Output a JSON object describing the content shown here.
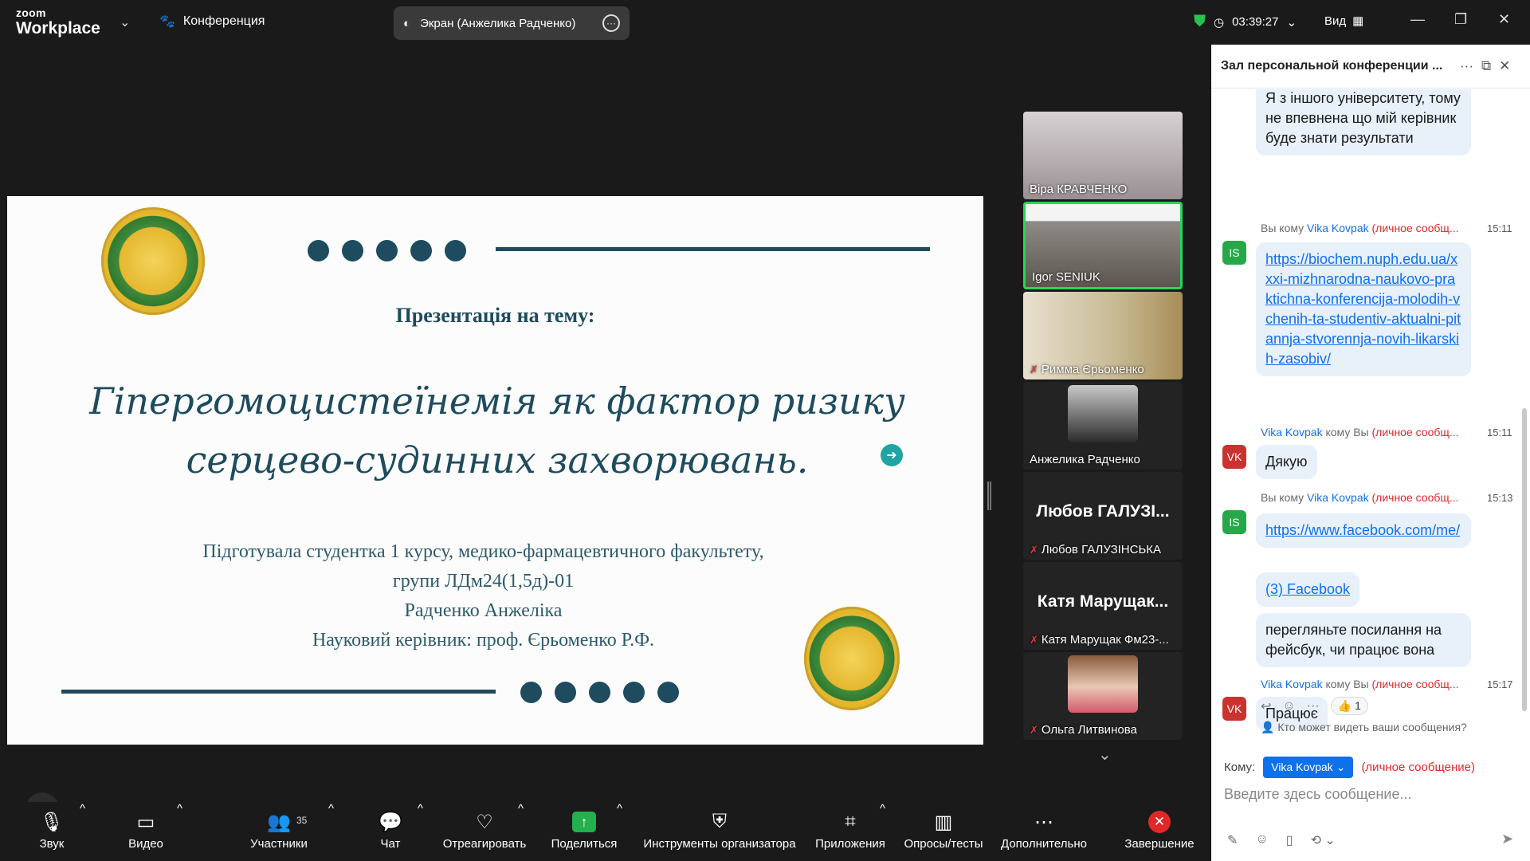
{
  "app": {
    "brand_small": "zoom",
    "brand_big": "Workplace"
  },
  "topbar": {
    "meeting_menu": "Конференция",
    "share_label": "Экран (Анжелика Радченко)",
    "timer": "03:39:27",
    "view_label": "Вид"
  },
  "slide": {
    "subtitle": "Презентація на тему:",
    "title": "Гіпергомоцистеїнемія як фактор ризику серцево-судинних захворювань.",
    "author_lines": [
      "Підготувала студентка 1 курсу, медико-фармацевтичного факультету,",
      "групи ЛДм24(1,5д)-01",
      "Радченко Анжеліка",
      "Науковий керівник: проф. Єрьоменко Р.Ф."
    ]
  },
  "gallery": [
    {
      "name": "Віра КРАВЧЕНКО",
      "muted": false
    },
    {
      "name": "Igor SENIUK",
      "muted": false,
      "active": true
    },
    {
      "name": "Римма Єрьоменко",
      "muted": true
    },
    {
      "name": "Анжелика Радченко",
      "muted": false
    },
    {
      "name": "Любов ГАЛУЗІНСЬКА",
      "big": "Любов ГАЛУЗІ...",
      "muted": true
    },
    {
      "name": "Катя Марущак Фм23-...",
      "big": "Катя Марущак...",
      "muted": true
    },
    {
      "name": "Ольга Литвинова",
      "muted": true
    }
  ],
  "chat": {
    "title": "Зал персональной конференции ...",
    "messages": [
      {
        "text": "Я з іншого університету, тому не впевнена що мій керівник буде знати результати"
      },
      {
        "meta_prefix": "Вы кому",
        "who": "Vika Kovpak",
        "pm": "(личное сообщ...",
        "time": "15:11",
        "avatar": "IS",
        "text": "https://biochem.nuph.edu.ua/xxxi-mizhnarodna-naukovo-praktichna-konferencija-molodih-vchenih-ta-studentiv-aktualni-pitannja-stvorennja-novih-likarskih-zasobiv/"
      },
      {
        "who": "Vika Kovpak",
        "meta_suffix": "кому Вы",
        "pm": "(личное сообщ...",
        "time": "15:11",
        "avatar": "VK",
        "text": "Дякую"
      },
      {
        "meta_prefix": "Вы кому",
        "who": "Vika Kovpak",
        "pm": "(личное сообщ...",
        "time": "15:13",
        "avatar": "IS",
        "text": "https://www.facebook.com/me/",
        "text2": "(3) Facebook",
        "text3": "перегляньте посилання на фейсбук, чи працює вона"
      },
      {
        "who": "Vika Kovpak",
        "meta_suffix": "кому Вы",
        "pm": "(личное сообщ...",
        "time": "15:17",
        "avatar": "VK",
        "text": "Працює",
        "reaction_count": "1"
      }
    ],
    "who_sees": "Кто может видеть ваши сообщения?",
    "to_label": "Кому:",
    "to_value": "Vika Kovpak",
    "to_pm": "(личное сообщение)",
    "placeholder": "Введите здесь сообщение..."
  },
  "toolbar": {
    "audio": "Звук",
    "video": "Видео",
    "participants": "Участники",
    "participants_count": "35",
    "chat": "Чат",
    "react": "Отреагировать",
    "share": "Поделиться",
    "host_tools": "Инструменты организатора",
    "apps": "Приложения",
    "polls": "Опросы/тесты",
    "more": "Дополнительно",
    "end": "Завершение"
  },
  "colors": {
    "accent": "#0e71eb",
    "slide_text": "#1e4b5e",
    "share_green": "#22b14c",
    "end_red": "#e02828",
    "active_tile": "#23d959"
  }
}
